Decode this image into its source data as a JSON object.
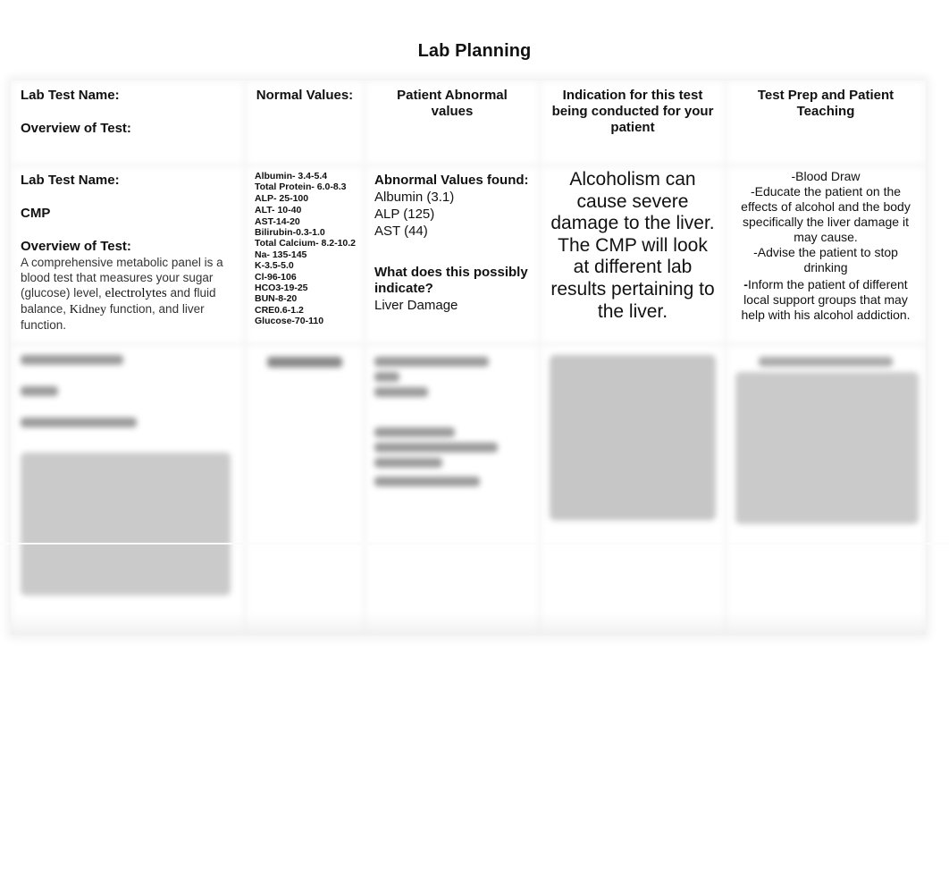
{
  "document": {
    "title": "Lab Planning"
  },
  "table": {
    "headers": {
      "col1_line1": "Lab Test Name:",
      "col1_line2": "Overview of Test:",
      "col2": "Normal Values:",
      "col3": "Patient Abnormal values",
      "col4": "Indication for this test being conducted for your patient",
      "col5": "Test Prep and Patient Teaching"
    },
    "row1": {
      "lab_test_label": "Lab Test Name:",
      "lab_test_name": "CMP",
      "overview_label": "Overview of Test:",
      "overview_parts": {
        "p1": "A comprehensive metabolic panel is a blood test that measures your sugar (glucose) level, ",
        "p2": "electrolytes",
        "p3": " and fluid balance, ",
        "p4": "Kidney",
        "p5": " function, and liver function."
      },
      "normal_values": [
        "Albumin- 3.4-5.4",
        "Total Protein- 6.0-8.3",
        "ALP- 25-100",
        "ALT- 10-40",
        "AST-14-20",
        "Bilirubin-0.3-1.0",
        "Total Calcium- 8.2-10.2",
        "Na- 135-145",
        "K-3.5-5.0",
        "Cl-96-106",
        "HCO3-19-25",
        "BUN-8-20",
        "CRE0.6-1.2",
        "Glucose-70-110"
      ],
      "abnormal_label": "Abnormal Values found:",
      "abnormal_values": [
        "Albumin (3.1)",
        "ALP (125)",
        "AST (44)"
      ],
      "indicate_label": "What does this possibly indicate?",
      "indicate_value": "Liver Damage",
      "indication": "Alcoholism can cause severe damage to the liver. The CMP will look at different lab results pertaining to the liver.",
      "teaching": [
        "-Blood Draw",
        "-Educate the patient on the effects of alcohol and the body specifically the liver damage it may cause.",
        "-Advise the patient to stop drinking",
        "Inform the patient of different local support groups that may help with his alcohol addiction."
      ],
      "teaching_last_dash": "-"
    },
    "row2": {
      "blurred": true
    }
  }
}
